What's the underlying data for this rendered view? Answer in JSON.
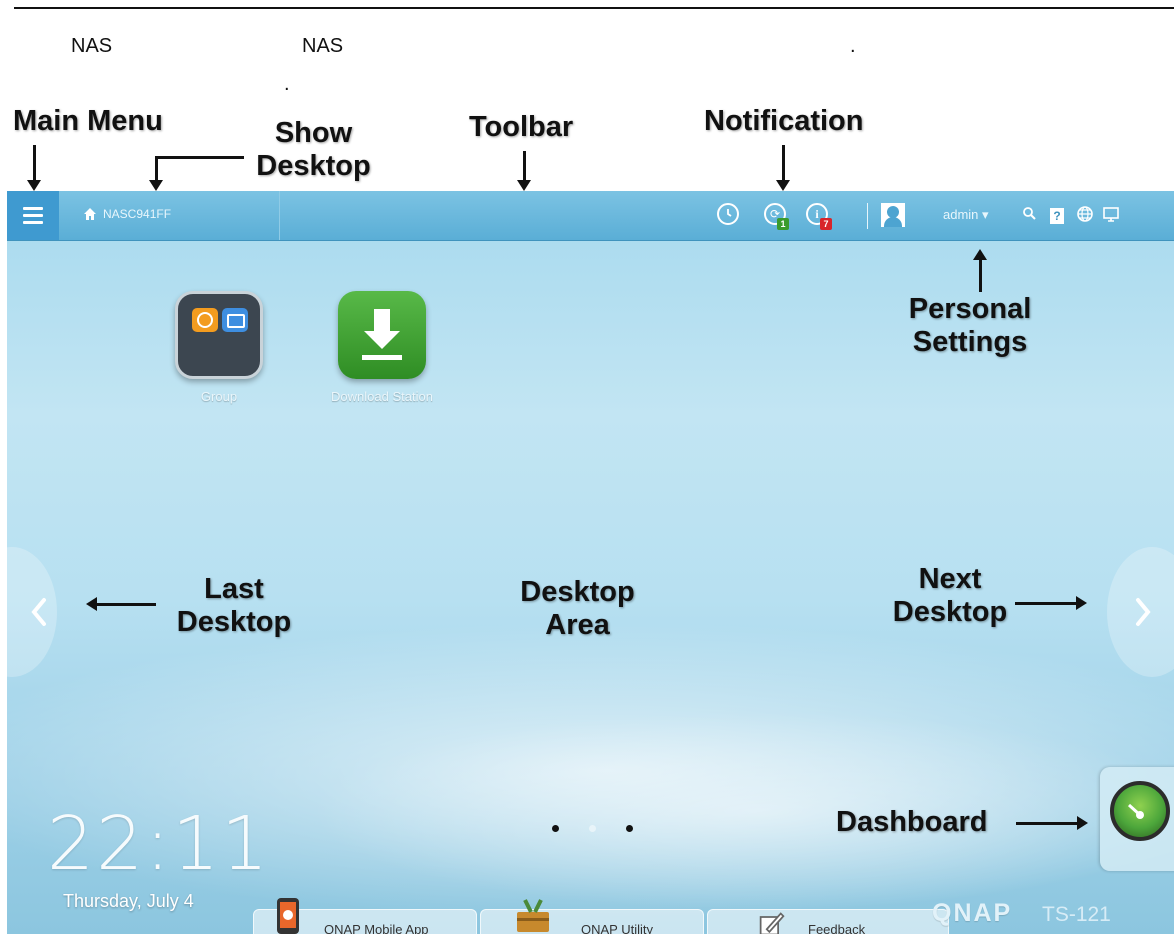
{
  "doc": {
    "line1_a": "NAS",
    "line1_b": "NAS",
    "line1_dot": ".",
    "line2_dot": "."
  },
  "callouts": {
    "main_menu": "Main Menu",
    "show_desktop_1": "Show",
    "show_desktop_2": "Desktop",
    "toolbar": "Toolbar",
    "notification": "Notification",
    "personal_1": "Personal",
    "personal_2": "Settings",
    "last_1": "Last",
    "last_2": "Desktop",
    "desktop_area_1": "Desktop",
    "desktop_area_2": "Area",
    "next_1": "Next",
    "next_2": "Desktop",
    "dashboard": "Dashboard"
  },
  "topbar": {
    "nas_name": "NASC941FF",
    "badge_sync": "1",
    "badge_info": "7",
    "username": "admin",
    "user_caret": "▾",
    "help_icon_text": "?"
  },
  "apps": [
    {
      "label": "Group",
      "icon": "folder-group-icon"
    },
    {
      "label": "Download Station",
      "icon": "download-arrow-icon"
    }
  ],
  "clock": {
    "time": "22:11",
    "date": "Thursday, July 4"
  },
  "page_dots": {
    "active": 1,
    "count": 3
  },
  "taskbar": [
    {
      "label": "QNAP Mobile App",
      "icon": "phone-icon"
    },
    {
      "label": "QNAP Utility",
      "icon": "toolbox-icon"
    },
    {
      "label": "Feedback",
      "icon": "pencil-note-icon"
    }
  ],
  "brand": {
    "logo": "QNAP",
    "model": "TS-121"
  },
  "colors": {
    "topbar": "#5aaed6",
    "menu_button": "#3f9ad0",
    "desktop": "#b7e0f1",
    "badge_green": "#3a9b2c",
    "badge_red": "#d8252a",
    "download_green": "#3f9e2f"
  }
}
